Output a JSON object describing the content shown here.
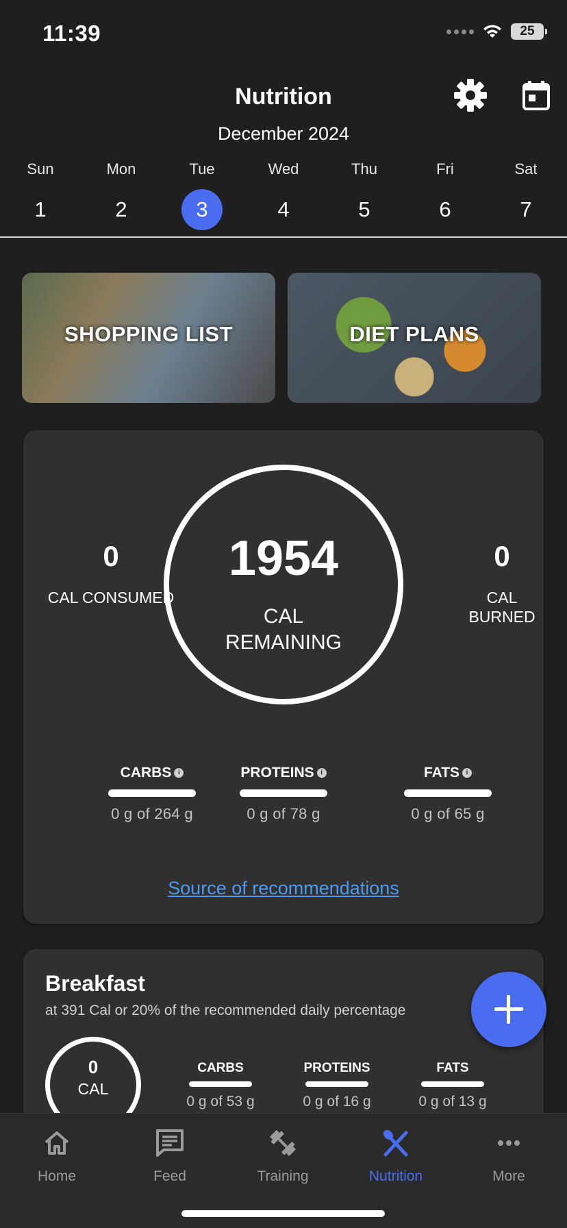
{
  "status_bar": {
    "time": "11:39",
    "battery": "25"
  },
  "header": {
    "title": "Nutrition",
    "month": "December 2024"
  },
  "week": [
    {
      "name": "Sun",
      "num": "1"
    },
    {
      "name": "Mon",
      "num": "2"
    },
    {
      "name": "Tue",
      "num": "3",
      "selected": true
    },
    {
      "name": "Wed",
      "num": "4"
    },
    {
      "name": "Thu",
      "num": "5"
    },
    {
      "name": "Fri",
      "num": "6"
    },
    {
      "name": "Sat",
      "num": "7"
    }
  ],
  "promos": {
    "shopping": "SHOPPING LIST",
    "diet": "DIET PLANS"
  },
  "summary": {
    "remaining_value": "1954",
    "remaining_label": "CAL REMAINING",
    "consumed_value": "0",
    "consumed_label": "CAL CONSUMED",
    "burned_value": "0",
    "burned_label": "CAL BURNED",
    "macros": [
      {
        "name": "CARBS",
        "amount": "0 g of 264 g"
      },
      {
        "name": "PROTEINS",
        "amount": "0 g of 78 g"
      },
      {
        "name": "FATS",
        "amount": "0 g of 65 g"
      }
    ],
    "source_link": "Source of recommendations"
  },
  "breakfast": {
    "title": "Breakfast",
    "subtitle": "at 391 Cal or 20% of the recommended daily percentage",
    "cal_value": "0",
    "cal_label": "CAL",
    "macros": [
      {
        "name": "CARBS",
        "amount": "0 g of 53 g"
      },
      {
        "name": "PROTEINS",
        "amount": "0 g of 16 g"
      },
      {
        "name": "FATS",
        "amount": "0 g of 13 g"
      }
    ]
  },
  "tabs": [
    {
      "label": "Home",
      "icon": "home-icon"
    },
    {
      "label": "Feed",
      "icon": "feed-icon"
    },
    {
      "label": "Training",
      "icon": "dumbbell-icon"
    },
    {
      "label": "Nutrition",
      "icon": "utensils-icon",
      "active": true
    },
    {
      "label": "More",
      "icon": "more-icon"
    }
  ],
  "colors": {
    "accent": "#4a6cf0",
    "link": "#4c9bf2",
    "background": "#1f1f20",
    "card": "#303031"
  }
}
